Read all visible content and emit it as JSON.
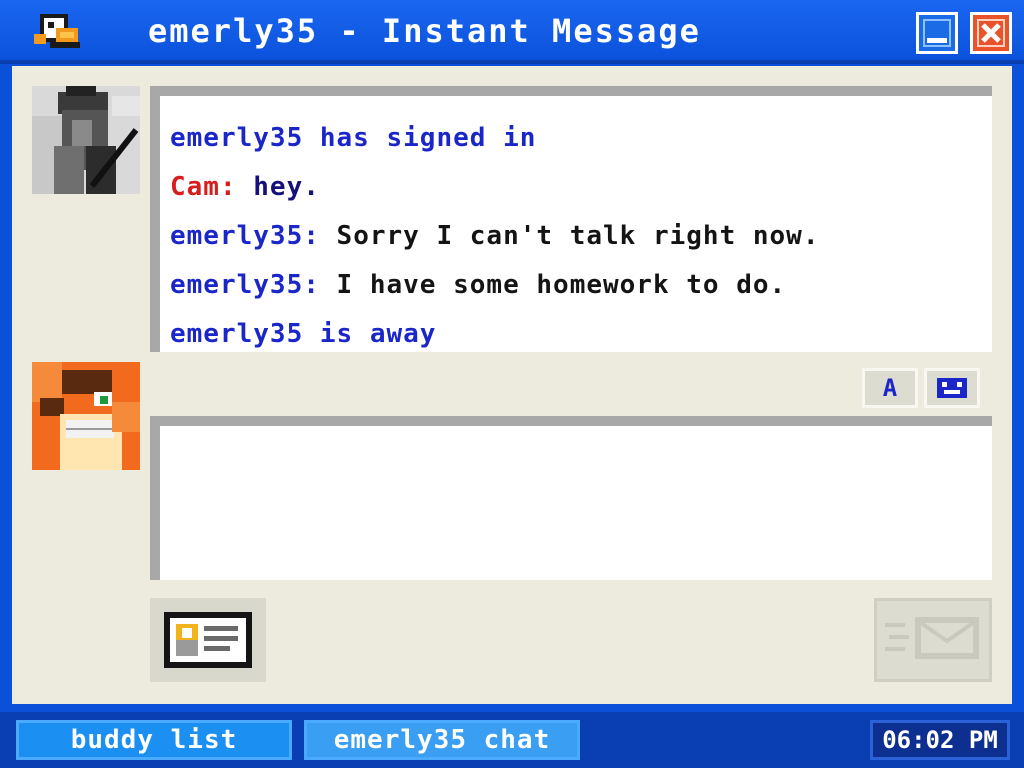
{
  "window": {
    "title": "emerly35 - Instant Message",
    "icon": "duck-messenger-icon",
    "minimize_icon": "minimize-icon",
    "close_icon": "close-icon"
  },
  "avatars": {
    "buddy": "buddy-avatar-image",
    "self": "self-avatar-image"
  },
  "chat": {
    "lines": [
      {
        "text": "emerly35 has signed in"
      },
      {
        "sender": "Cam:",
        "message": " hey."
      },
      {
        "sender": "emerly35:",
        "message": " Sorry I can't talk right now."
      },
      {
        "sender": "emerly35:",
        "message": " I have some homework to do."
      },
      {
        "text": "emerly35 is away"
      }
    ]
  },
  "format_buttons": {
    "font_label": "A",
    "font_icon": "font-style-icon",
    "smiley_icon": "emoticon-icon"
  },
  "compose": {
    "value": ""
  },
  "actions": {
    "profile_icon": "profile-card-icon",
    "send_icon": "send-envelope-icon"
  },
  "taskbar": {
    "buddy_list": "buddy list",
    "chat_tab": "emerly35 chat",
    "clock": "06:02 PM"
  },
  "colors": {
    "system_text": "#1b26c9",
    "buddy_name": "#d81d1d",
    "buddy_message": "#16117a",
    "self_message": "#141414",
    "window_blue": "#0b50d8",
    "panel_bg": "#ecebdd"
  }
}
